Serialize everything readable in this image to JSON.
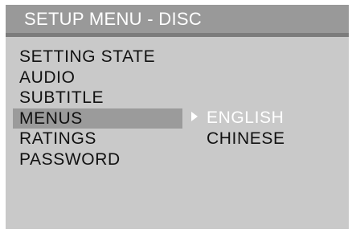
{
  "title": "SETUP MENU - DISC",
  "menu": {
    "items": [
      {
        "label": "SETTING STATE"
      },
      {
        "label": "AUDIO"
      },
      {
        "label": "SUBTITLE"
      },
      {
        "label": "MENUS"
      },
      {
        "label": "RATINGS"
      },
      {
        "label": "PASSWORD"
      }
    ],
    "selected_index": 3
  },
  "options": {
    "items": [
      {
        "label": "ENGLISH"
      },
      {
        "label": "CHINESE"
      }
    ],
    "active_index": 0,
    "pointer_icon": "triangle-right-icon"
  },
  "colors": {
    "panel_bg": "#c9c9c9",
    "title_bar": "#999999",
    "divider": "#7c7c7c",
    "highlight": "#9b9b9b",
    "active_text": "#ffffff",
    "text": "#111111"
  }
}
